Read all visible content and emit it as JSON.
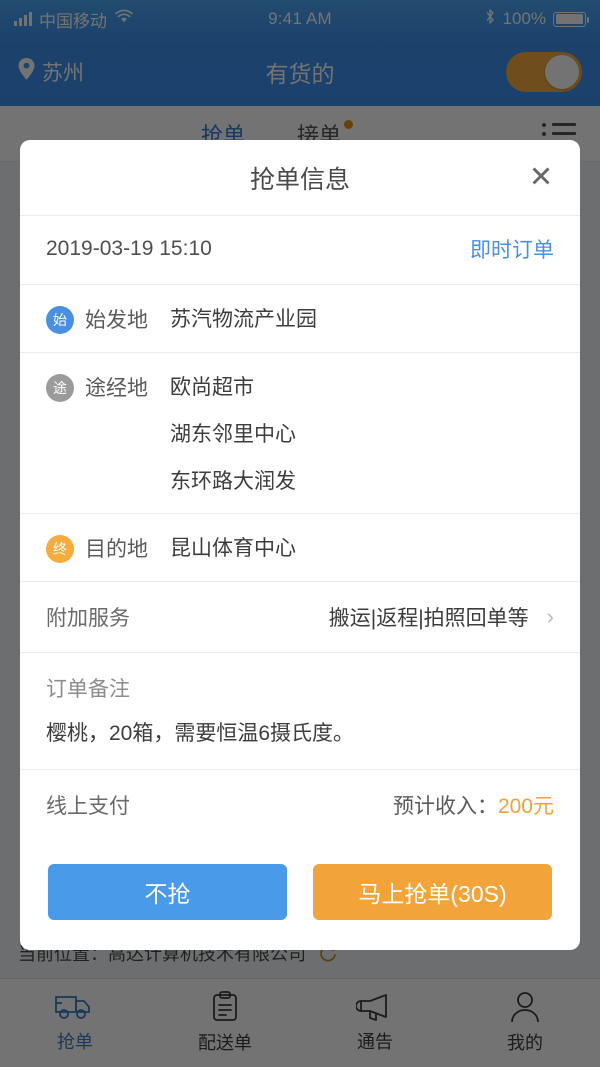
{
  "status_bar": {
    "carrier": "中国移动",
    "time": "9:41 AM",
    "battery_percent": "100%",
    "signal_icon": "signal-bars-icon",
    "wifi_icon": "wifi-icon",
    "bluetooth_icon": "bluetooth-icon",
    "battery_icon": "battery-icon"
  },
  "nav": {
    "city": "苏州",
    "location_icon": "location-pin-icon",
    "title": "有货的",
    "toggle_state": "on",
    "toggle_color": "#f5ab3e"
  },
  "segment_tabs": {
    "items": [
      {
        "label": "抢单",
        "active": true,
        "badge": false
      },
      {
        "label": "接单",
        "active": false,
        "badge": true
      }
    ],
    "menu_icon": "list-menu-icon",
    "badge_color": "#e39316"
  },
  "dialog": {
    "title": "抢单信息",
    "close_icon": "close-icon",
    "order": {
      "time": "2019-03-19 15:10",
      "type": "即时订单",
      "type_color": "#4a90e2"
    },
    "origin": {
      "badge": "始",
      "label": "始发地",
      "value": "苏汽物流产业园",
      "badge_color": "#4a90e2"
    },
    "waypoints": {
      "badge": "途",
      "label": "途经地",
      "values": [
        "欧尚超市",
        "湖东邻里中心",
        "东环路大润发"
      ],
      "badge_color": "#9b9b9b"
    },
    "destination": {
      "badge": "终",
      "label": "目的地",
      "value": "昆山体育中心",
      "badge_color": "#f5ab3e"
    },
    "extra_service": {
      "label": "附加服务",
      "value": "搬运|返程|拍照回单等",
      "chevron_icon": "chevron-right-icon"
    },
    "remark": {
      "label": "订单备注",
      "text": "樱桃，20箱，需要恒温6摄氏度。"
    },
    "payment": {
      "method": "线上支付",
      "income_label": "预计收入：",
      "income_value": "200元",
      "income_color": "#f0a33a"
    },
    "actions": {
      "decline": "不抢",
      "decline_color": "#4a9aea",
      "accept": "马上抢单(30S)",
      "accept_color": "#f2a43a"
    }
  },
  "location_bar": {
    "text": "当前位置：高达计算机技术有限公司",
    "refresh_icon": "refresh-icon",
    "refresh_color": "#c58a2e"
  },
  "tab_bar": {
    "items": [
      {
        "label": "抢单",
        "icon": "truck-icon",
        "active": true
      },
      {
        "label": "配送单",
        "icon": "clipboard-icon",
        "active": false
      },
      {
        "label": "通告",
        "icon": "megaphone-icon",
        "active": false
      },
      {
        "label": "我的",
        "icon": "person-icon",
        "active": false
      }
    ],
    "active_color": "#3b7fc4"
  }
}
